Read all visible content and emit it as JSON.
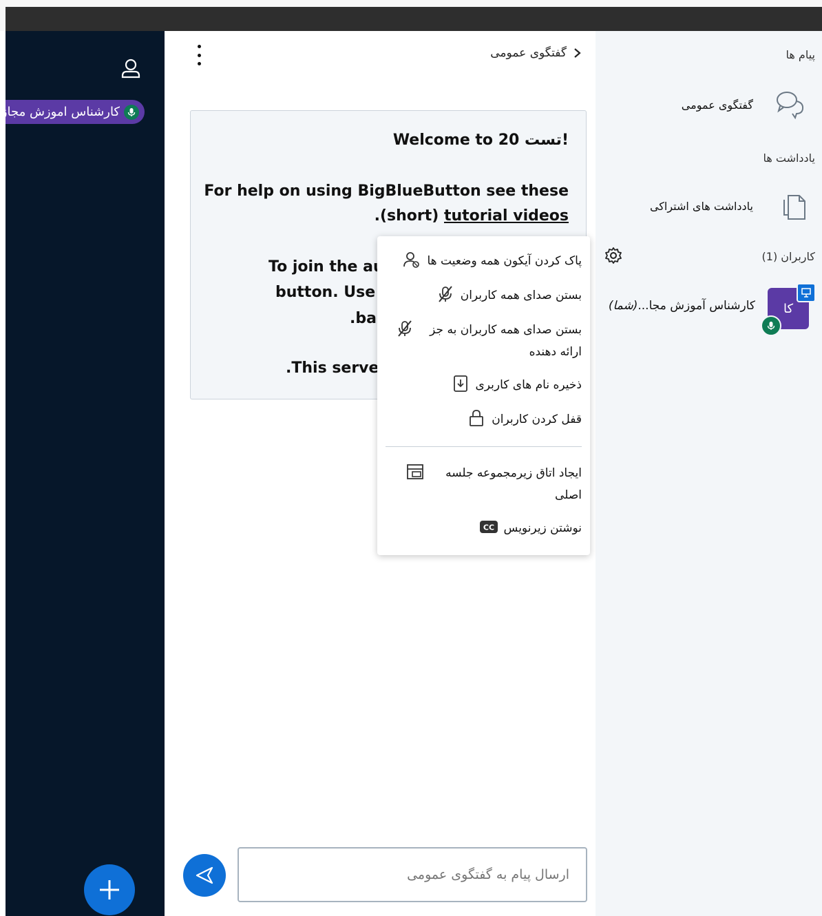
{
  "media": {
    "talking_user_label": "کارشناس اموزش مجازی"
  },
  "chat": {
    "title": "گفتگوی عمومی",
    "welcome": {
      "line1_a": "Welcome to ",
      "line1_b": "تست 20!",
      "line2": "For help on using BigBlueButton see these",
      "line3_a": ".(short) ",
      "line3_link": "tutorial videos",
      "line4": "To join the auc",
      "line5": "button. Use a",
      "line6": ".bac",
      "line7": ".This server"
    },
    "input_placeholder": "ارسال پیام به گفتگوی عمومی"
  },
  "sidebar": {
    "messages_title": "پیام ها",
    "public_chat_label": "گفتگوی عمومی",
    "notes_title": "یادداشت ها",
    "shared_notes_label": "یادداشت های اشتراکی",
    "users_title": "کاربران (1)",
    "user": {
      "initials": "کا",
      "name": "کارشناس آموزش مجا...",
      "you_tag": "(شما)"
    }
  },
  "menu": {
    "items": [
      {
        "label": "پاک کردن آیکون همه وضعیت ها",
        "icon": "clear-status-icon"
      },
      {
        "label": "بستن صدای همه کاربران",
        "icon": "mute-icon"
      },
      {
        "label": "بستن صدای همه کاربران به جز ارائه دهنده",
        "icon": "mute-icon"
      },
      {
        "label": "ذخیره نام های کاربری",
        "icon": "download-icon"
      },
      {
        "label": "قفل کردن کاربران",
        "icon": "lock-icon"
      },
      {
        "label": "ایجاد اتاق زیرمجموعه جلسه اصلی",
        "icon": "breakout-room-icon"
      },
      {
        "label": "نوشتن زیرنویس",
        "icon": "closed-caption-icon"
      }
    ]
  },
  "colors": {
    "primary": "#0f70d7",
    "avatar": "#5b3aa5",
    "mic_green": "#0e7c55",
    "presentation_bg": "#06172a"
  }
}
